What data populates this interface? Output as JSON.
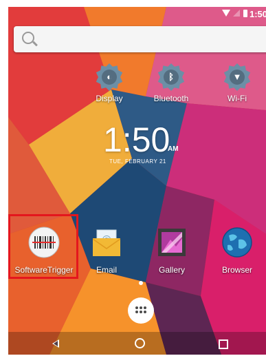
{
  "status_bar": {
    "time": "1:50"
  },
  "quick_settings": [
    {
      "label": "Display",
      "icon": "display-settings-icon",
      "glyph": "◐"
    },
    {
      "label": "Bluetooth",
      "icon": "bluetooth-settings-icon",
      "glyph": "ᛒ"
    },
    {
      "label": "Wi-Fi",
      "icon": "wifi-settings-icon",
      "glyph": "▼"
    }
  ],
  "clock": {
    "time": "1:50",
    "ampm": "AM",
    "date": "TUE, FEBRUARY 21"
  },
  "apps": [
    {
      "label": "SoftwareTrigger",
      "icon": "barcode-scanner-icon"
    },
    {
      "label": "Email",
      "icon": "email-icon"
    },
    {
      "label": "Gallery",
      "icon": "gallery-icon"
    },
    {
      "label": "Browser",
      "icon": "globe-icon"
    }
  ],
  "colors": {
    "highlight": "#e4161d"
  }
}
